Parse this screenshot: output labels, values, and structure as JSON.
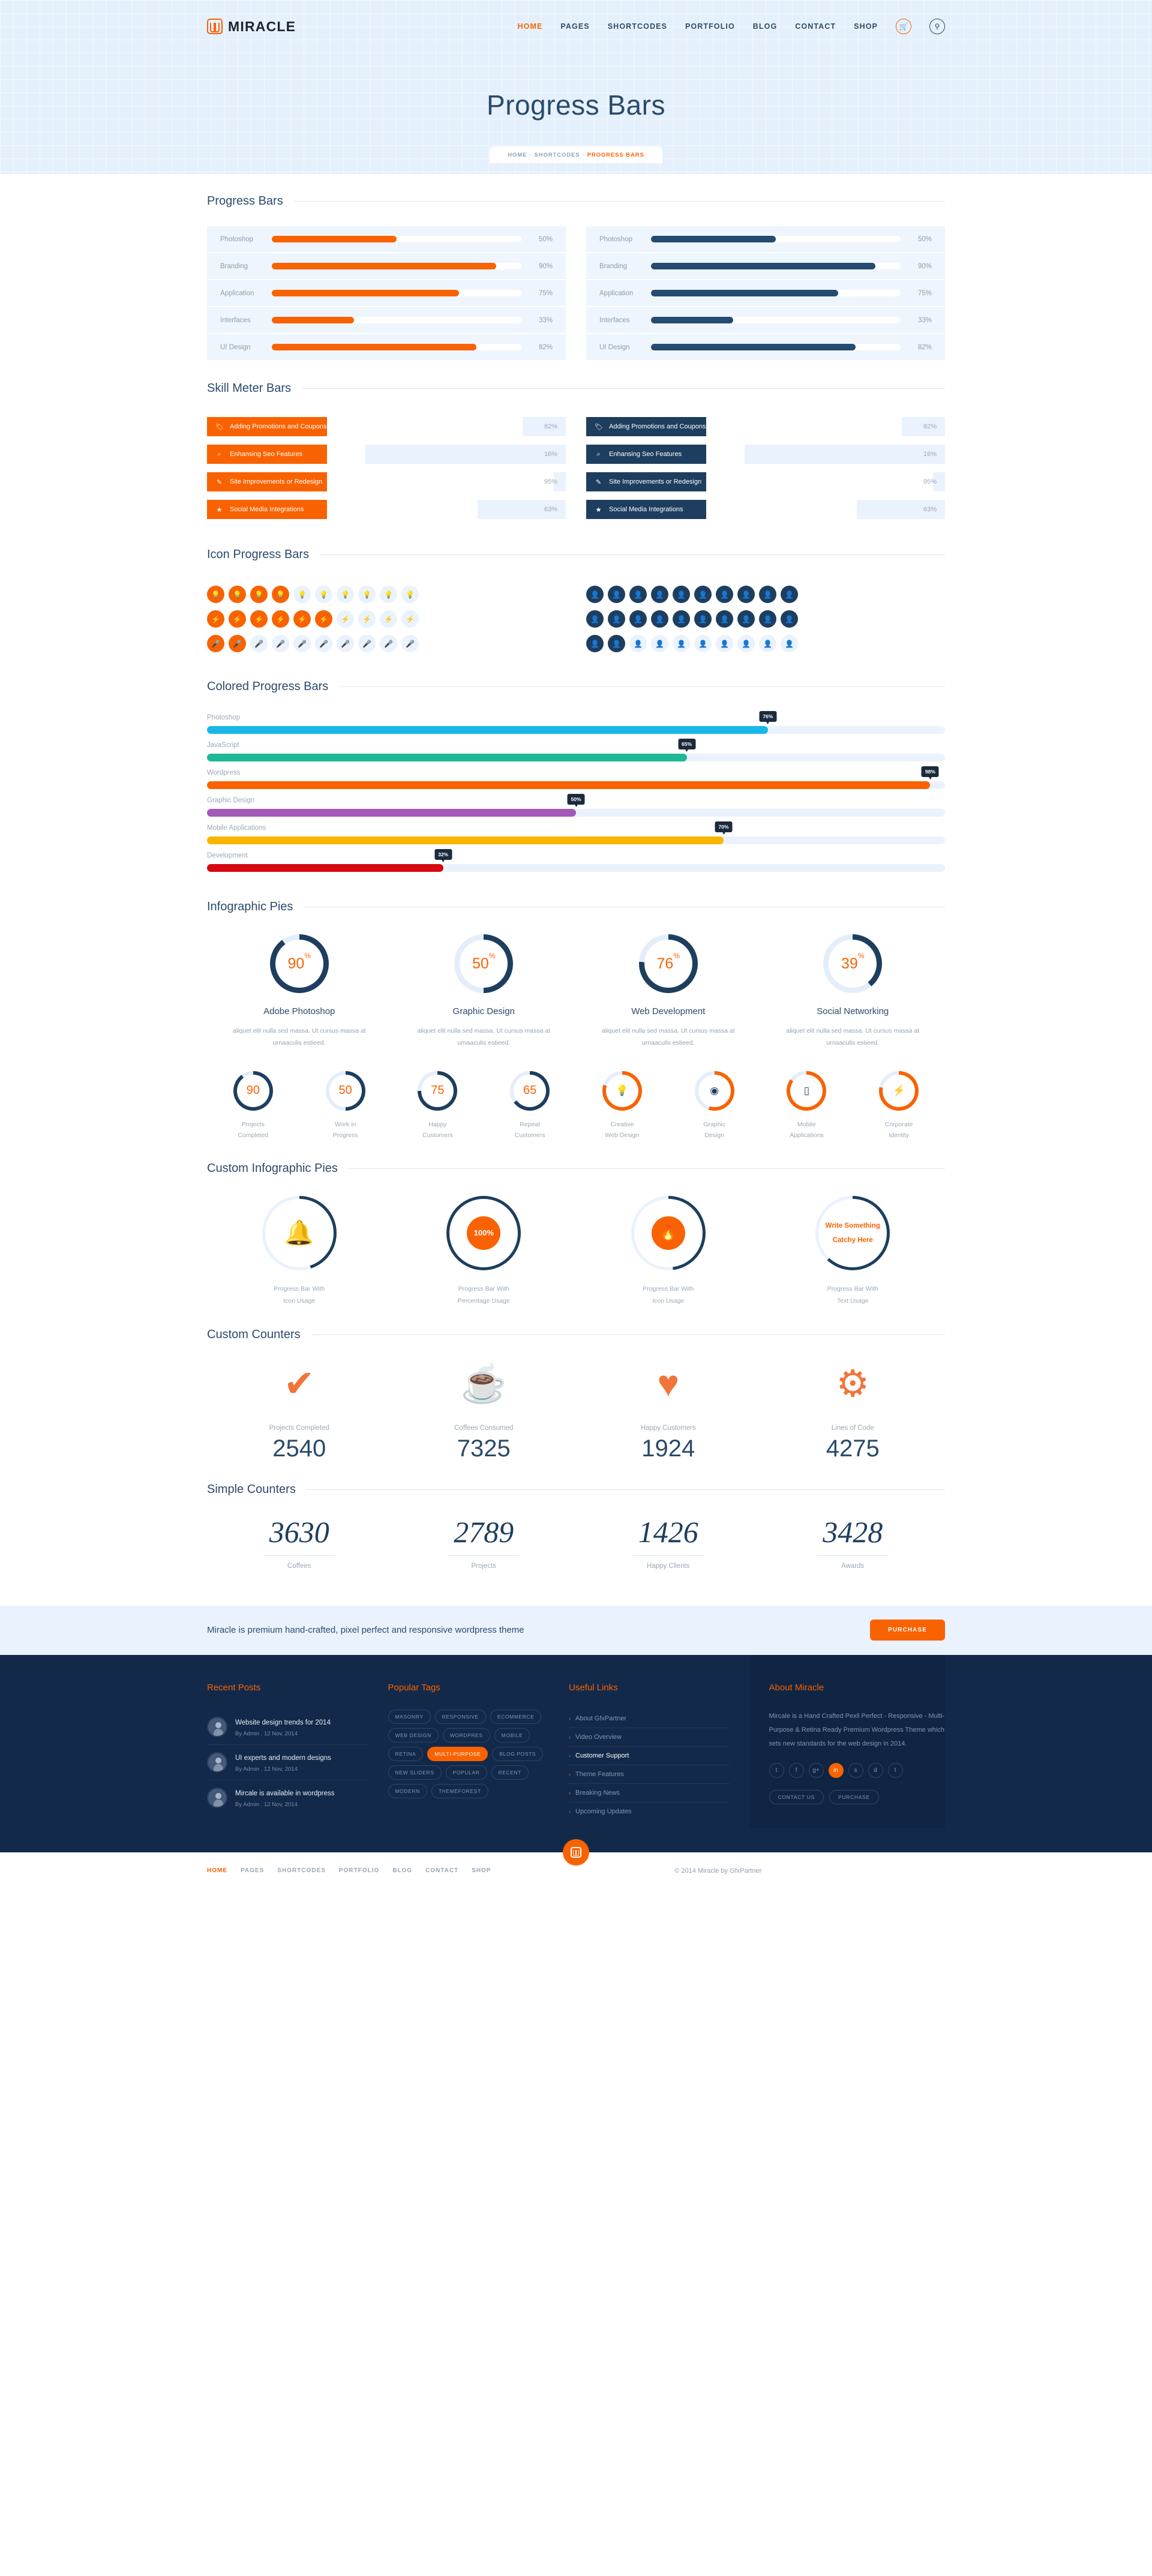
{
  "header": {
    "logo": "MIRACLE",
    "nav": [
      "HOME",
      "PAGES",
      "SHORTCODES",
      "PORTFOLIO",
      "BLOG",
      "CONTACT",
      "SHOP"
    ],
    "cart_icon": "cart-icon",
    "search_icon": "search-icon"
  },
  "hero": {
    "title": "Progress Bars",
    "breadcrumb": {
      "home": "HOME",
      "section": "SHORTCODES",
      "current": "PROGRESS BARS"
    }
  },
  "sections": {
    "progress_bars": "Progress Bars",
    "skill_meter": "Skill Meter Bars",
    "icon_progress": "Icon Progress Bars",
    "colored": "Colored Progress Bars",
    "infographic_pies": "Infographic Pies",
    "custom_pies": "Custom Infographic Pies",
    "custom_counters": "Custom Counters",
    "simple_counters": "Simple Counters"
  },
  "chart_data": [
    {
      "type": "bar",
      "title": "Progress Bars (orange)",
      "categories": [
        "Photoshop",
        "Branding",
        "Application",
        "Interfaces",
        "UI Design"
      ],
      "values": [
        50,
        90,
        75,
        33,
        82
      ],
      "labels": [
        "50%",
        "90%",
        "75%",
        "33%",
        "82%"
      ],
      "color": "#f96200",
      "track": "#ffffff",
      "ylim": [
        0,
        100
      ]
    },
    {
      "type": "bar",
      "title": "Progress Bars (dark)",
      "categories": [
        "Photoshop",
        "Branding",
        "Application",
        "Interfaces",
        "UI Design"
      ],
      "values": [
        50,
        90,
        75,
        33,
        82
      ],
      "labels": [
        "50%",
        "90%",
        "75%",
        "33%",
        "82%"
      ],
      "color": "#254b70",
      "track": "#ffffff",
      "ylim": [
        0,
        100
      ]
    },
    {
      "type": "bar",
      "title": "Skill Meter Bars",
      "categories": [
        "Adding Promotions and Coupons",
        "Enhansing Seo Features",
        "Site Improvements or Redesign",
        "Social Media Integrations"
      ],
      "values": [
        82,
        16,
        95,
        63
      ],
      "labels": [
        "82%",
        "16%",
        "95%",
        "63%"
      ],
      "icons": [
        "tag-icon",
        "search-icon",
        "pencil-icon",
        "star-icon"
      ],
      "color_orange": "#f96200",
      "color_dark": "#1d3e5e",
      "ylim": [
        0,
        100
      ]
    },
    {
      "type": "bar",
      "title": "Icon Progress Bars",
      "categories": [
        "bulb",
        "bolt",
        "mic"
      ],
      "values": [
        4,
        6,
        2
      ],
      "total": 10,
      "icons_orange": [
        "bulb-icon",
        "bolt-icon",
        "mic-icon"
      ],
      "right_values": [
        10,
        10,
        2
      ],
      "right_icon": "user-icon",
      "ylim": [
        0,
        10
      ]
    },
    {
      "type": "bar",
      "title": "Colored Progress Bars",
      "categories": [
        "Photoshop",
        "JavaScript",
        "Wordpress",
        "Graphic Design",
        "Mobile Applications",
        "Development"
      ],
      "values": [
        76,
        65,
        98,
        50,
        70,
        32
      ],
      "labels": [
        "76%",
        "65%",
        "98%",
        "50%",
        "70%",
        "32%"
      ],
      "colors": [
        "#17b8e8",
        "#1fb894",
        "#f96200",
        "#a459b8",
        "#f9b500",
        "#d60812"
      ],
      "track": "#eaf2fd",
      "ylim": [
        0,
        100
      ]
    },
    {
      "type": "pie",
      "title": "Infographic Pies",
      "categories": [
        "Adobe Photoshop",
        "Graphic Design",
        "Web Development",
        "Social Networking"
      ],
      "values": [
        90,
        50,
        76,
        39
      ],
      "labels": [
        "90",
        "50",
        "76",
        "39"
      ],
      "suffix": "%",
      "color": "#1d3e5e",
      "track": "#e4eefb",
      "descriptions": [
        "aliquet elit nulla sed massa. Ut cursus massa at urnaaculis estieed.",
        "aliquet elit nulla sed massa. Ut cursus massa at urnaaculis estieed.",
        "aliquet elit nulla sed massa. Ut cursus massa at urnaaculis estieed.",
        "aliquet elit nulla sed massa. Ut cursus massa at urnaaculis estieed."
      ]
    },
    {
      "type": "pie",
      "title": "Counter Rings",
      "categories": [
        "Projects Completed",
        "Work in Progress",
        "Happy Customers",
        "Repeat Customers",
        "Creative Web Design",
        "Graphic Design",
        "Mobile Applications",
        "Corporate Identity"
      ],
      "values": [
        90,
        50,
        75,
        65,
        80,
        55,
        85,
        78
      ],
      "labels": [
        "90",
        "50",
        "75",
        "65",
        "",
        "",
        "",
        ""
      ],
      "icons": [
        "",
        "",
        "",
        "",
        "bulb-icon",
        "eye-icon",
        "mobile-icon",
        "bolt-icon"
      ],
      "colors": [
        "#1d3e5e",
        "#1d3e5e",
        "#1d3e5e",
        "#1d3e5e",
        "#f96200",
        "#f96200",
        "#f96200",
        "#f96200"
      ]
    },
    {
      "type": "pie",
      "title": "Custom Infographic Pies",
      "categories": [
        "Progress Bar With Icon Usage",
        "Progress Bar With Percentage Usage",
        "Progress Bar With Icon Usage",
        "Progress Bar With Text Usage"
      ],
      "values": [
        45,
        100,
        48,
        62
      ],
      "inner_labels": [
        "",
        "100%",
        "",
        "Write Something Catchy Here"
      ],
      "inner_icons": [
        "bell-icon",
        "",
        "flame-icon",
        ""
      ],
      "color": "#1d3e5e",
      "track": "#e4eefb"
    },
    {
      "type": "bar",
      "title": "Custom Counters",
      "categories": [
        "Projects Completed",
        "Coffees Consumed",
        "Happy Customers",
        "Lines of Code"
      ],
      "values": [
        2540,
        7325,
        1924,
        4275
      ],
      "icons": [
        "check-icon",
        "coffee-icon",
        "heart-icon",
        "gear-icon"
      ],
      "color": "#f0753a"
    },
    {
      "type": "bar",
      "title": "Simple Counters",
      "categories": [
        "Coffees",
        "Projects",
        "Happy Clients",
        "Awards"
      ],
      "values": [
        3630,
        2789,
        1426,
        3428
      ],
      "color": "#1d3e5e"
    }
  ],
  "progress_left": {
    "rows": [
      {
        "label": "Photoshop",
        "pct": "50%",
        "v": 50
      },
      {
        "label": "Branding",
        "pct": "90%",
        "v": 90
      },
      {
        "label": "Application",
        "pct": "75%",
        "v": 75
      },
      {
        "label": "Interfaces",
        "pct": "33%",
        "v": 33
      },
      {
        "label": "UI Design",
        "pct": "82%",
        "v": 82
      }
    ]
  },
  "progress_right": {
    "rows": [
      {
        "label": "Photoshop",
        "pct": "50%",
        "v": 50
      },
      {
        "label": "Branding",
        "pct": "90%",
        "v": 90
      },
      {
        "label": "Application",
        "pct": "75%",
        "v": 75
      },
      {
        "label": "Interfaces",
        "pct": "33%",
        "v": 33
      },
      {
        "label": "UI Design",
        "pct": "82%",
        "v": 82
      }
    ]
  },
  "skills": [
    {
      "label": "Adding Promotions and Coupons",
      "pct": "82%",
      "v": 82,
      "icon": "🏷"
    },
    {
      "label": "Enhansing Seo Features",
      "pct": "16%",
      "v": 16,
      "icon": "⌕"
    },
    {
      "label": "Site Improvements or Redesign",
      "pct": "95%",
      "v": 95,
      "icon": "✎"
    },
    {
      "label": "Social Media Integrations",
      "pct": "63%",
      "v": 63,
      "icon": "★"
    }
  ],
  "icon_rows_left": [
    {
      "icon": "💡",
      "on": 4,
      "total": 10
    },
    {
      "icon": "⚡",
      "on": 6,
      "total": 10
    },
    {
      "icon": "🎤",
      "on": 2,
      "total": 10
    }
  ],
  "icon_rows_right": [
    {
      "icon": "👤",
      "on": 10,
      "total": 10
    },
    {
      "icon": "👤",
      "on": 10,
      "total": 10
    },
    {
      "icon": "👤",
      "on": 2,
      "total": 10
    }
  ],
  "colored": [
    {
      "label": "Photoshop",
      "pct": "76%",
      "v": 76,
      "color": "#17b8e8"
    },
    {
      "label": "JavaScript",
      "pct": "65%",
      "v": 65,
      "color": "#1fb894"
    },
    {
      "label": "Wordpress",
      "pct": "98%",
      "v": 98,
      "color": "#f96200"
    },
    {
      "label": "Graphic Design",
      "pct": "50%",
      "v": 50,
      "color": "#a459b8"
    },
    {
      "label": "Mobile Applications",
      "pct": "70%",
      "v": 70,
      "color": "#f9b500"
    },
    {
      "label": "Development",
      "pct": "32%",
      "v": 32,
      "color": "#d60812"
    }
  ],
  "pies": [
    {
      "v": 90,
      "num": "90",
      "title": "Adobe Photoshop",
      "desc": "aliquet elit nulla sed massa. Ut cursus massa at urnaaculis estieed."
    },
    {
      "v": 50,
      "num": "50",
      "title": "Graphic Design",
      "desc": "aliquet elit nulla sed massa. Ut cursus massa at urnaaculis estieed."
    },
    {
      "v": 76,
      "num": "76",
      "title": "Web Development",
      "desc": "aliquet elit nulla sed massa. Ut cursus massa at urnaaculis estieed."
    },
    {
      "v": 39,
      "num": "39",
      "title": "Social Networking",
      "desc": "aliquet elit nulla sed massa. Ut cursus massa at urnaaculis estieed."
    }
  ],
  "counter_rings": [
    {
      "num": "90",
      "v": 90,
      "cap": "Projects\nCompleted",
      "color": "#1d3e5e"
    },
    {
      "num": "50",
      "v": 50,
      "cap": "Work in\nProgress",
      "color": "#1d3e5e"
    },
    {
      "num": "75",
      "v": 75,
      "cap": "Happy\nCustomers",
      "color": "#1d3e5e"
    },
    {
      "num": "65",
      "v": 65,
      "cap": "Repeat\nCustomers",
      "color": "#1d3e5e"
    },
    {
      "ico": "💡",
      "v": 80,
      "cap": "Creative\nWeb Design",
      "color": "#f96200"
    },
    {
      "ico": "◉",
      "v": 55,
      "cap": "Graphic\nDesign",
      "color": "#f96200"
    },
    {
      "ico": "▯",
      "v": 85,
      "cap": "Mobile\nApplications",
      "color": "#f96200"
    },
    {
      "ico": "⚡",
      "v": 78,
      "cap": "Corporate\nIdentity",
      "color": "#f96200"
    }
  ],
  "custom_pies": [
    {
      "v": 45,
      "mode": "bigicon",
      "ico": "🔔",
      "cap": "Progress Bar With\nIcon Usage"
    },
    {
      "v": 100,
      "mode": "disc",
      "text": "100%",
      "cap": "Progress Bar With\nPercentage Usage"
    },
    {
      "v": 48,
      "mode": "discicon",
      "ico": "🔥",
      "cap": "Progress Bar With\nIcon Usage"
    },
    {
      "v": 62,
      "mode": "text",
      "text": "Write Something\nCatchy Here",
      "cap": "Progress Bar With\nText Usage"
    }
  ],
  "custom_counters": [
    {
      "glyph": "✔",
      "label": "Projects Completed",
      "value": "2540"
    },
    {
      "glyph": "☕",
      "label": "Coffees Consumed",
      "value": "7325"
    },
    {
      "glyph": "♥",
      "label": "Happy Customers",
      "value": "1924"
    },
    {
      "glyph": "⚙",
      "label": "Lines of Code",
      "value": "4275"
    }
  ],
  "simple_counters": [
    {
      "value": "3630",
      "label": "Coffees"
    },
    {
      "value": "2789",
      "label": "Projects"
    },
    {
      "value": "1426",
      "label": "Happy Clients"
    },
    {
      "value": "3428",
      "label": "Awards"
    }
  ],
  "purchase_bar": {
    "message": "Miracle is premium hand-crafted, pixel perfect and responsive wordpress theme",
    "button": "PURCHASE"
  },
  "footer": {
    "recent_posts_title": "Recent Posts",
    "posts": [
      {
        "title": "Website design trends for 2014",
        "meta": "By Admin  .  12 Nov, 2014"
      },
      {
        "title": "UI experts and modern designs",
        "meta": "By Admin  .  12 Nov, 2014"
      },
      {
        "title": "Mircale is available in wordpress",
        "meta": "By Admin  .  12 Nov, 2014"
      }
    ],
    "tags_title": "Popular Tags",
    "tags": [
      {
        "t": "MASONRY",
        "on": false
      },
      {
        "t": "RESPONSIVE",
        "on": false
      },
      {
        "t": "ECOMMERCE",
        "on": false
      },
      {
        "t": "WEB DESIGN",
        "on": false
      },
      {
        "t": "WORDPRES",
        "on": false
      },
      {
        "t": "MOBILE",
        "on": false
      },
      {
        "t": "RETINA",
        "on": false
      },
      {
        "t": "MULTI-PURPOSE",
        "on": true
      },
      {
        "t": "BLOG POSTS",
        "on": false
      },
      {
        "t": "NEW SLIDERS",
        "on": false
      },
      {
        "t": "POPULAR",
        "on": false
      },
      {
        "t": "RECENT",
        "on": false
      },
      {
        "t": "MODERN",
        "on": false
      },
      {
        "t": "THEMEFOREST",
        "on": false
      }
    ],
    "links_title": "Useful Links",
    "links": [
      {
        "t": "About GfxPartner",
        "on": false
      },
      {
        "t": "Video Overview",
        "on": false
      },
      {
        "t": "Customer Support",
        "on": true
      },
      {
        "t": "Theme Features",
        "on": false
      },
      {
        "t": "Breaking News",
        "on": false
      },
      {
        "t": "Upcoming Updates",
        "on": false
      }
    ],
    "about_title": "About Miracle",
    "about_text": "Mircale is a Hand Crafted Pexil Perfect - Responsive - Multi-Purpose & Retina Ready Premium Wordpress Theme which sets new standards for the web design in 2014.",
    "socials": [
      {
        "g": "t",
        "on": false
      },
      {
        "g": "f",
        "on": false
      },
      {
        "g": "g+",
        "on": false
      },
      {
        "g": "in",
        "on": true
      },
      {
        "g": "s",
        "on": false
      },
      {
        "g": "d",
        "on": false
      },
      {
        "g": "t",
        "on": false
      }
    ],
    "buttons": [
      "CONTACT US",
      "PURCHASE"
    ]
  },
  "bottom": {
    "nav": [
      "HOME",
      "PAGES",
      "SHORTCODES",
      "PORTFOLIO",
      "BLOG",
      "CONTACT",
      "SHOP"
    ],
    "copyright": "© 2014 Miracle by GfxPartner"
  }
}
